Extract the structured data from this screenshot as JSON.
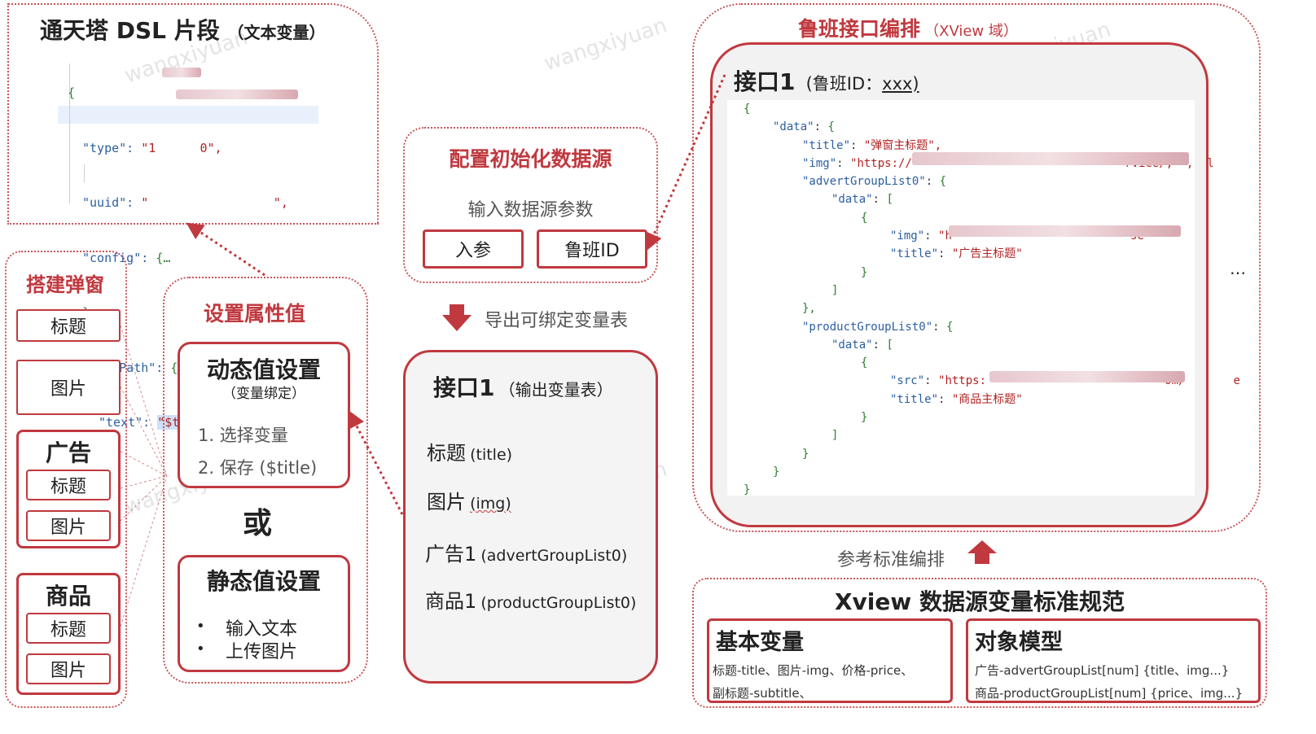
{
  "dsl": {
    "title": "通天塔 DSL 片段",
    "subtitle": "（文本变量）",
    "lines": [
      {
        "indent": 0,
        "k": "{",
        "v": ""
      },
      {
        "indent": 1,
        "k": "\"type\": ",
        "v": "\"1      0\","
      },
      {
        "indent": 1,
        "k": "\"uuid\": ",
        "v": "\"                 \","
      },
      {
        "indent": 1,
        "k": "\"config\": ",
        "v": "{…"
      },
      {
        "indent": 1,
        "k": "},",
        "v": ""
      },
      {
        "indent": 1,
        "k": "\"dataPath\": ",
        "v": "{"
      },
      {
        "indent": 2,
        "k": "\"text\": ",
        "v": "\"$title\""
      },
      {
        "indent": 1,
        "k": "}",
        "v": ""
      },
      {
        "indent": 0,
        "k": "}",
        "v": ""
      }
    ]
  },
  "build_popup": {
    "title": "搭建弹窗",
    "title_item": "标题",
    "image_item": "图片",
    "ad_group": {
      "title": "广告",
      "items": [
        "标题",
        "图片"
      ]
    },
    "product_group": {
      "title": "商品",
      "items": [
        "标题",
        "图片"
      ]
    }
  },
  "set_attr": {
    "title": "设置属性值",
    "dynamic": {
      "title": "动态值设置",
      "subtitle": "（变量绑定）",
      "steps": [
        "1. 选择变量",
        "2. 保存 ($title)"
      ]
    },
    "or_label": "或",
    "static": {
      "title": "静态值设置",
      "bullets": [
        "输入文本",
        "上传图片"
      ]
    }
  },
  "init_source": {
    "title": "配置初始化数据源",
    "desc": "输入数据源参数",
    "btn_params": "入参",
    "btn_luban": "鲁班ID"
  },
  "export_label": "导出可绑定变量表",
  "output_table": {
    "title": "接口1",
    "subtitle": "（输出变量表）",
    "rows": [
      {
        "cn": "标题",
        "en": "(title)"
      },
      {
        "cn": "图片",
        "en": "(img)"
      },
      {
        "cn": "广告1",
        "en": "(advertGroupList0)"
      },
      {
        "cn": "商品1",
        "en": "(productGroupList0)"
      }
    ]
  },
  "luban": {
    "title": "鲁班接口编排",
    "domain": "（XView 域）",
    "api_title": "接口1",
    "api_id_label": "(鲁班ID：",
    "api_id_value": "xxx)",
    "more": "…",
    "json_lines": [
      {
        "i": 0,
        "t": "{"
      },
      {
        "i": 1,
        "t": "\"data\": {"
      },
      {
        "i": 2,
        "t": "\"title\": \"弹窗主标题\","
      },
      {
        "i": 2,
        "t": "\"img\": \"https://                               rvice/,  ,  l"
      },
      {
        "i": 2,
        "t": "\"advertGroupList0\": {"
      },
      {
        "i": 3,
        "t": "\"data\": ["
      },
      {
        "i": 4,
        "t": "{"
      },
      {
        "i": 5,
        "t": "\"img\": \"h                          se"
      },
      {
        "i": 5,
        "t": "\"title\": \"广告主标题\""
      },
      {
        "i": 4,
        "t": "}"
      },
      {
        "i": 3,
        "t": "]"
      },
      {
        "i": 2,
        "t": "},"
      },
      {
        "i": 2,
        "t": "\"productGroupList0\": {"
      },
      {
        "i": 3,
        "t": "\"data\": ["
      },
      {
        "i": 4,
        "t": "{"
      },
      {
        "i": 5,
        "t": "\"src\": \"https:                          om/       e"
      },
      {
        "i": 5,
        "t": "\"title\": \"商品主标题\""
      },
      {
        "i": 4,
        "t": "}"
      },
      {
        "i": 3,
        "t": "]"
      },
      {
        "i": 2,
        "t": "}"
      },
      {
        "i": 1,
        "t": "}"
      },
      {
        "i": 0,
        "t": "}"
      }
    ]
  },
  "ref_label": "参考标准编排",
  "spec": {
    "title": "Xview 数据源变量标准规范",
    "basic": {
      "title": "基本变量",
      "line1": "标题-title、图片-img、价格-price、",
      "line2": "副标题-subtitle、"
    },
    "object": {
      "title": "对象模型",
      "line1": "广告-advertGroupList[num]  {title、img...}",
      "line2": "商品-productGroupList[num] {price、img...}"
    }
  },
  "watermark": "wangxiyuan",
  "colors": {
    "accent": "#c0393f",
    "key": "#2c5fa0",
    "string": "#b22222",
    "punct": "#2e7d32"
  }
}
